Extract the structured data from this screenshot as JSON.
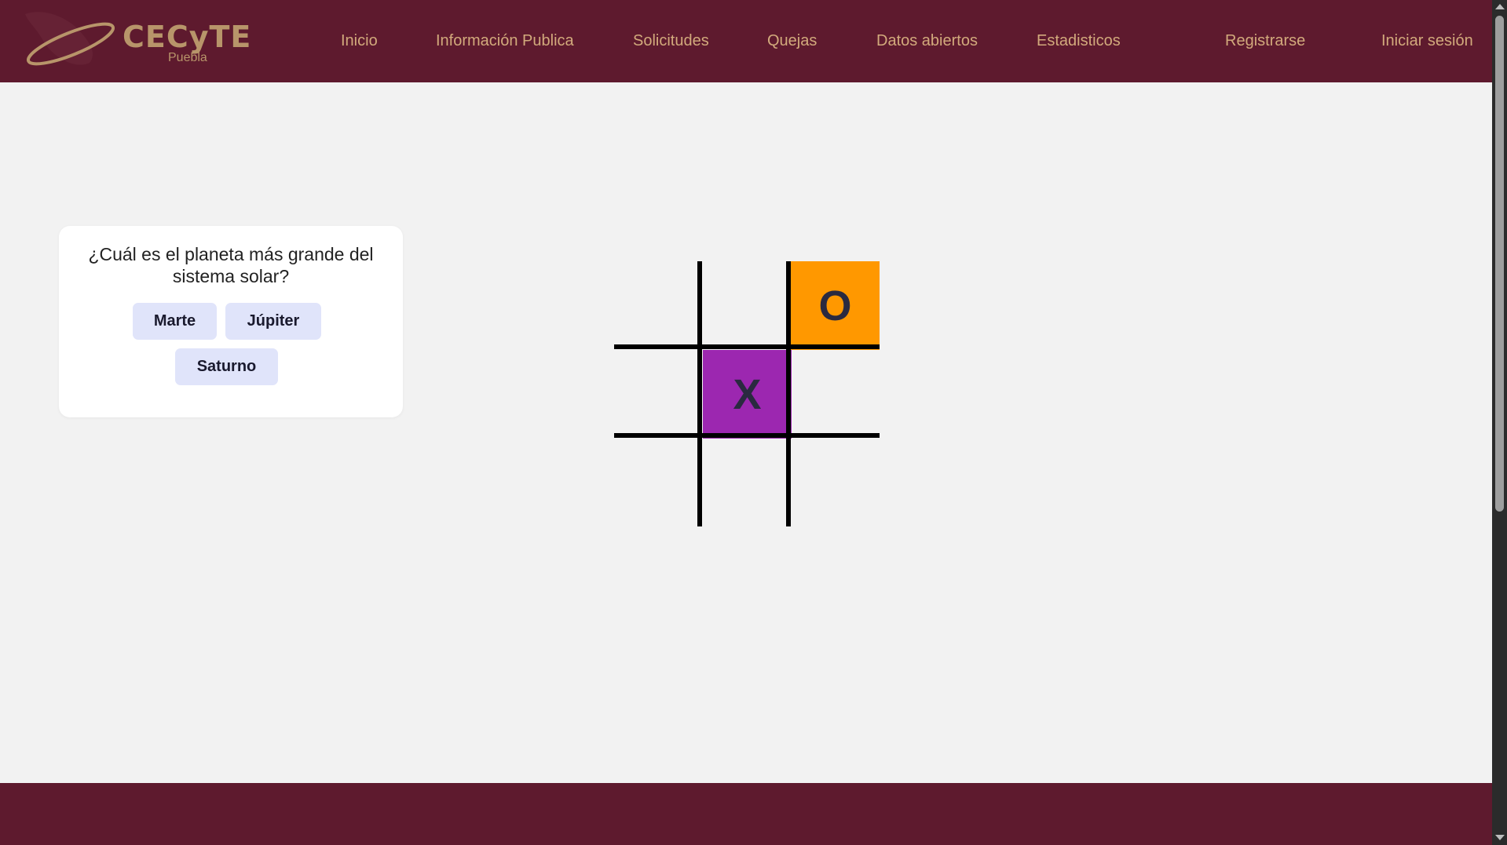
{
  "logo": {
    "wordmark": "CECyTE",
    "subtitle": "Puebla",
    "icon": "orbit-logo-icon"
  },
  "nav": {
    "items": [
      {
        "label": "Inicio"
      },
      {
        "label": "Información Publica"
      },
      {
        "label": "Solicitudes"
      },
      {
        "label": "Quejas"
      },
      {
        "label": "Datos abiertos"
      },
      {
        "label": "Estadisticos"
      },
      {
        "label": "Registrarse"
      },
      {
        "label": "Iniciar sesión"
      }
    ]
  },
  "quiz": {
    "question": "¿Cuál es el planeta más grande del sistema solar?",
    "answers": [
      {
        "label": "Marte"
      },
      {
        "label": "Júpiter"
      },
      {
        "label": "Saturno"
      }
    ]
  },
  "board": {
    "cells": [
      "",
      "",
      "O",
      "",
      "X",
      "",
      "",
      "",
      ""
    ],
    "x_color": "#9c27b0",
    "o_color": "#ff9800",
    "line_color": "#000000"
  },
  "theme": {
    "header_bg": "#5e1a2e",
    "nav_text": "#d2aa7c",
    "page_bg": "#f2f2f2",
    "button_bg": "#e0e4fa"
  }
}
